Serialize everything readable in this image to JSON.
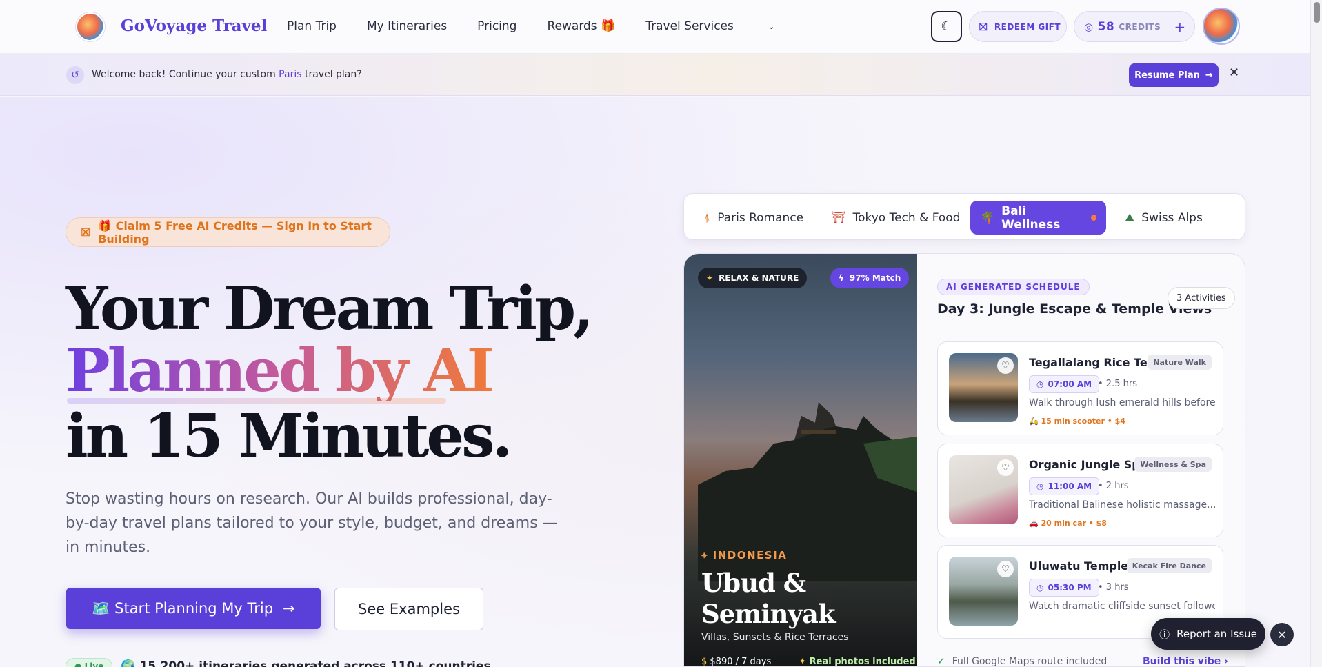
{
  "brand": {
    "name": "GoVoyage Travel"
  },
  "nav": {
    "items": [
      "Plan Trip",
      "My Itineraries",
      "Pricing",
      "Rewards 🎁",
      "Travel Services"
    ]
  },
  "header": {
    "redeem_label": "REDEEM GIFT",
    "credits_count": "58",
    "credits_label": "CREDITS",
    "plus_label": "+"
  },
  "banner": {
    "text_before": "Welcome back! Continue your custom ",
    "highlight": "Paris",
    "text_after": " travel plan?",
    "resume_label": "Resume Plan",
    "close": "✕"
  },
  "hero": {
    "claim": "🎁 Claim 5 Free AI Credits — Sign In to Start Building",
    "line1": "Your Dream Trip,",
    "line2": "Planned by AI",
    "line3": "in 15 Minutes.",
    "subtitle": "Stop wasting hours on research. Our AI builds professional, day-by-day travel plans tailored to your style, budget, and dreams — in minutes.",
    "cta_primary": "🗺️ Start Planning My Trip",
    "cta_secondary": "See Examples",
    "live_badge": "● Live",
    "stat": "🌍 15,200+ itineraries generated across 110+ countries"
  },
  "tabs": [
    {
      "label": "Paris Romance",
      "icon": "eiffel-icon"
    },
    {
      "label": "Tokyo Tech & Food",
      "icon": "torii-icon"
    },
    {
      "label": "Bali Wellness",
      "icon": "palm-icon",
      "active": true
    },
    {
      "label": "Swiss Alps",
      "icon": "mountain-icon"
    }
  ],
  "photo": {
    "badge_vibe": "RELAX & NATURE",
    "badge_match": "97% Match",
    "country": "INDONESIA",
    "place_line1": "Ubud &",
    "place_line2": "Seminyak",
    "tagline": "Villas, Sunsets & Rice Terraces",
    "price": "$890 / 7 days",
    "photos": "Real photos included"
  },
  "schedule": {
    "ai_tag": "AI GENERATED SCHEDULE",
    "title": "Day 3: Jungle Escape & Temple Views",
    "count": "3 Activities",
    "items": [
      {
        "name": "Tegallalang Rice Terrac...",
        "tag": "Nature Walk",
        "time": "07:00 AM",
        "duration": "• 2.5 hrs",
        "desc": "Walk through lush emerald hills before...",
        "transport": "15 min scooter • $4"
      },
      {
        "name": "Organic Jungle Spa ...",
        "tag": "Wellness & Spa",
        "time": "11:00 AM",
        "duration": "• 2 hrs",
        "desc": "Traditional Balinese holistic massage...",
        "transport": "20 min car • $8"
      },
      {
        "name": "Uluwatu Temple Clif...",
        "tag": "Kecak Fire Dance",
        "time": "05:30 PM",
        "duration": "• 3 hrs",
        "desc": "Watch dramatic cliffside sunset followe...",
        "transport": ""
      }
    ],
    "maps_note": "Full Google Maps route included",
    "build_vibe": "Build this vibe ›"
  },
  "report": {
    "label": "Report an Issue",
    "close": "✕"
  }
}
